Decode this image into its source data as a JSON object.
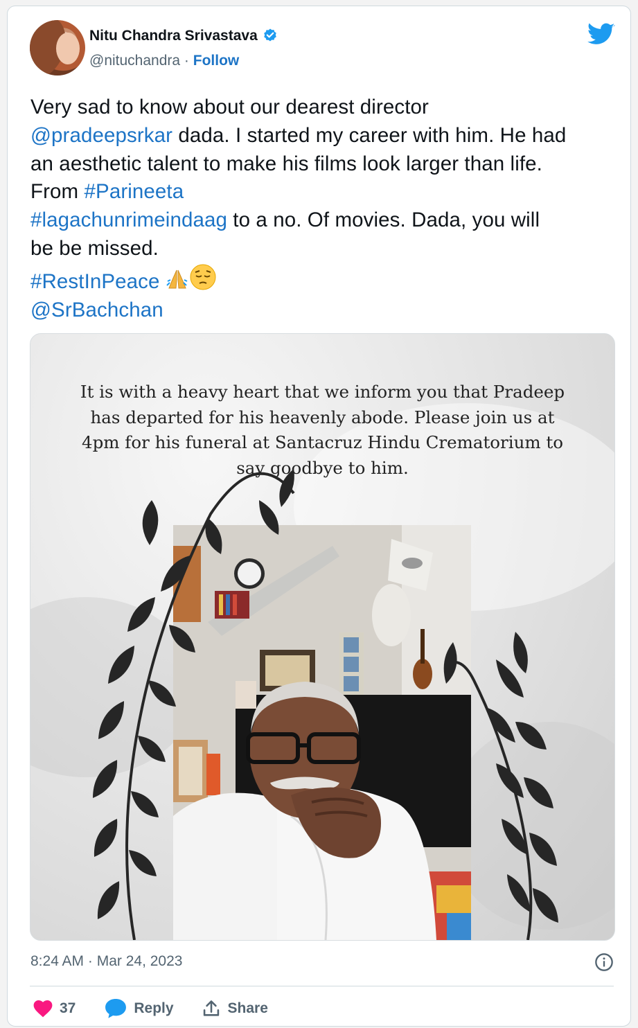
{
  "author": {
    "name": "Nitu Chandra Srivastava",
    "handle": "@nituchandra",
    "separator": "·",
    "follow_label": "Follow"
  },
  "tweet": {
    "lines": [
      [
        {
          "t": "Very sad to know about our dearest director",
          "link": false
        }
      ],
      [
        {
          "t": "@pradeepsrkar",
          "link": true
        },
        {
          "t": " dada. I started my career with him. He had",
          "link": false
        }
      ],
      [
        {
          "t": "an aesthetic talent to make his films look larger than life.",
          "link": false
        }
      ],
      [
        {
          "t": "From ",
          "link": false
        },
        {
          "t": "#Parineeta",
          "link": true
        }
      ],
      [
        {
          "t": "#lagachunrimeindaag",
          "link": true
        },
        {
          "t": " to a no. Of movies. Dada, you will",
          "link": false
        }
      ],
      [
        {
          "t": "be be missed.",
          "link": false
        }
      ],
      [
        {
          "t": "#RestInPeace",
          "link": true
        },
        {
          "t": " ",
          "link": false
        }
      ],
      [
        {
          "t": "@SrBachchan",
          "link": true
        }
      ]
    ],
    "emojis": [
      "folded-hands-emoji",
      "pensive-face-emoji"
    ]
  },
  "media": {
    "notice_lines": [
      "It is with a heavy heart that we inform you that Pradeep",
      "has departed for his heavenly abode. Please join us at",
      "4pm for his funeral at Santacruz Hindu Crematorium to",
      "say goodbye to him."
    ]
  },
  "meta": {
    "timestamp": "8:24 AM · Mar 24, 2023"
  },
  "actions": {
    "like_count": "37",
    "reply_label": "Reply",
    "share_label": "Share"
  },
  "colors": {
    "link": "#1d74c6",
    "twitter_blue": "#1d9bf0",
    "like_pink": "#f91880",
    "text": "#0f1419",
    "muted": "#536471"
  }
}
